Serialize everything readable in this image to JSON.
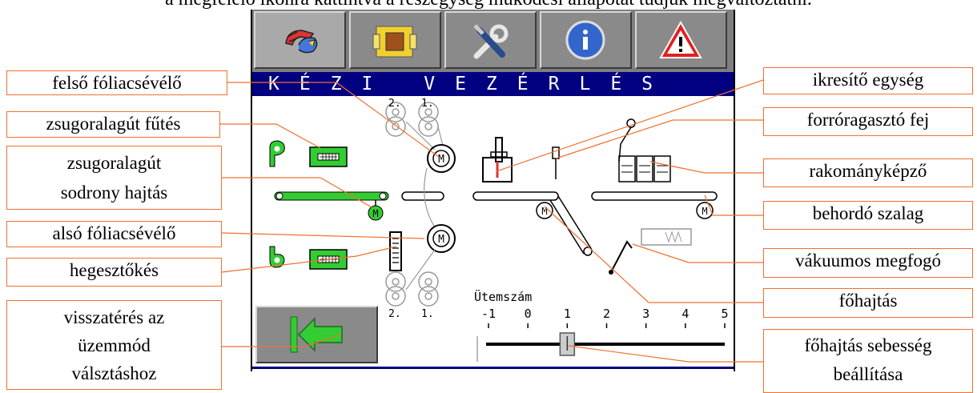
{
  "caption": "a megfelelő ikonra kattintva a részegység működési állapotát tudjuk megváltoztatni.",
  "screen": {
    "title": "KÉZI VEZÉRLÉS",
    "tabs": [
      {
        "name": "manual-control",
        "icon": "hand-rotate-icon"
      },
      {
        "name": "box",
        "icon": "box-icon"
      },
      {
        "name": "tools",
        "icon": "tools-icon"
      },
      {
        "name": "info",
        "icon": "info-icon"
      },
      {
        "name": "warning",
        "icon": "warning-icon"
      }
    ],
    "roll_numbers": {
      "top_left": "2.",
      "top_right": "1.",
      "bottom_left": "2.",
      "bottom_right": "1."
    },
    "motor_letter": "M",
    "slider": {
      "label": "Ütemszám",
      "ticks": [
        "-1",
        "0",
        "1",
        "2",
        "3",
        "4",
        "5"
      ],
      "value": 1
    }
  },
  "labels": {
    "upper_film_winder": "felső fóliacsévélő",
    "shrink_tunnel_heating": "zsugoralagút fűtés",
    "shrink_tunnel_drive_1": "zsugoralagút",
    "shrink_tunnel_drive_2": "sodrony hajtás",
    "lower_film_winder": "alsó fóliacsévélő",
    "welding_knife": "hegesztőkés",
    "back_1": "visszatérés az",
    "back_2": "üzemmód",
    "back_3": "válsztáshoz",
    "twin_unit": "ikresítő egység",
    "hot_glue_head": "forróragasztó fej",
    "load_former": "rakományképző",
    "infeed_belt": "behordó szalag",
    "vacuum_gripper": "vákuumos megfogó",
    "main_drive": "főhajtás",
    "main_drive_speed_1": "főhajtás sebesség",
    "main_drive_speed_2": "beállítása"
  },
  "colors": {
    "titlebar": "#000080",
    "leader_line": "#f07030",
    "active_green": "#33cc33"
  }
}
